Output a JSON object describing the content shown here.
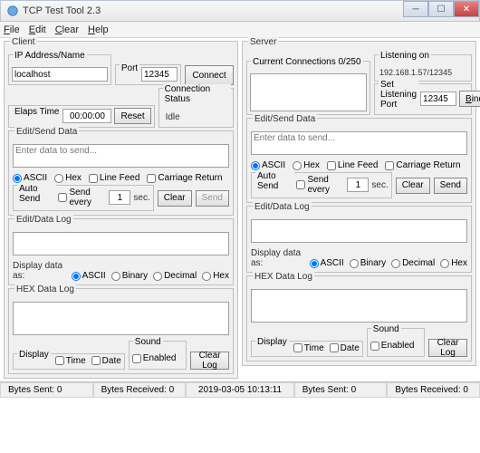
{
  "window": {
    "title": "TCP Test Tool 2.3"
  },
  "menu": {
    "file": "File",
    "edit": "Edit",
    "clear": "Clear",
    "help": "Help"
  },
  "client": {
    "legend": "Client",
    "ip_label": "IP Address/Name",
    "ip_value": "localhost",
    "port_label": "Port",
    "port_value": "12345",
    "connect": "Connect",
    "elapsed_label": "Elaps Time",
    "elapsed_value": "00:00:00",
    "reset": "Reset",
    "connstat_label": "Connection Status",
    "connstat_value": "Idle",
    "editsend": {
      "legend": "Edit/Send Data",
      "placeholder": "Enter data to send...",
      "ascii": "ASCII",
      "hex": "Hex",
      "lf": "Line Feed",
      "cr": "Carriage Return",
      "autosend_label": "Auto Send",
      "send_every": "Send every",
      "sec": "sec.",
      "every_value": "1",
      "clear": "Clear",
      "send": "Send"
    },
    "datalog": {
      "legend": "Edit/Data Log",
      "display_as": "Display data as:",
      "ascii": "ASCII",
      "binary": "Binary",
      "decimal": "Decimal",
      "hex": "Hex"
    },
    "hexlog": {
      "legend": "HEX Data Log",
      "display_label": "Display",
      "time": "Time",
      "date": "Date",
      "sound_label": "Sound",
      "enabled": "Enabled",
      "clearlog": "Clear Log"
    }
  },
  "server": {
    "legend": "Server",
    "cur_conn_label": "Current Connections 0/250",
    "listening_label": "Listening on",
    "listening_value": "192.168.1.57/12345",
    "setport_label": "Set Listening Port",
    "setport_value": "12345",
    "bind": "Bind",
    "editsend": {
      "legend": "Edit/Send Data",
      "placeholder": "Enter data to send...",
      "ascii": "ASCII",
      "hex": "Hex",
      "lf": "Line Feed",
      "cr": "Carriage Return",
      "autosend_label": "Auto Send",
      "send_every": "Send every",
      "sec": "sec.",
      "every_value": "1",
      "clear": "Clear",
      "send": "Send"
    },
    "datalog": {
      "legend": "Edit/Data Log",
      "display_as": "Display data as:",
      "ascii": "ASCII",
      "binary": "Binary",
      "decimal": "Decimal",
      "hex": "Hex"
    },
    "hexlog": {
      "legend": "HEX Data Log",
      "display_label": "Display",
      "time": "Time",
      "date": "Date",
      "sound_label": "Sound",
      "enabled": "Enabled",
      "clearlog": "Clear Log"
    }
  },
  "status": {
    "client_sent": "Bytes Sent: 0",
    "client_recv": "Bytes Received: 0",
    "timestamp": "2019-03-05 10:13:11",
    "server_sent": "Bytes Sent: 0",
    "server_recv": "Bytes Received: 0"
  }
}
